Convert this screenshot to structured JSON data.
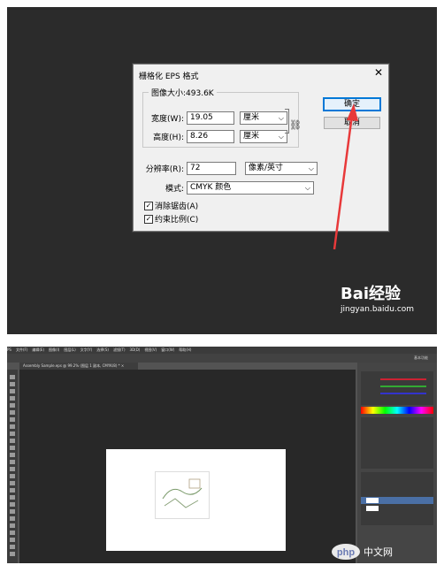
{
  "dialog": {
    "title": "栅格化 EPS 格式",
    "close": "✕",
    "image_size_label": "图像大小:493.6K",
    "width": {
      "label": "宽度(W):",
      "value": "19.05",
      "unit": "厘米"
    },
    "height": {
      "label": "高度(H):",
      "value": "8.26",
      "unit": "厘米"
    },
    "resolution": {
      "label": "分辨率(R):",
      "value": "72",
      "unit": "像素/英寸"
    },
    "mode": {
      "label": "模式:",
      "value": "CMYK 颜色"
    },
    "antialias": {
      "label": "消除锯齿(A)",
      "checked": true
    },
    "constrain": {
      "label": "约束比例(C)",
      "checked": true
    },
    "ok_label": "确定",
    "cancel_label": "取消"
  },
  "watermark": {
    "logo": "Bai经验",
    "site": "jingyan.baidu.com"
  },
  "photoshop": {
    "menu": [
      "PS",
      "文件(F)",
      "编辑(E)",
      "图像(I)",
      "图层(L)",
      "文字(Y)",
      "选择(S)",
      "滤镜(T)",
      "3D(D)",
      "视图(V)",
      "窗口(W)",
      "帮助(H)"
    ],
    "doc_tab": "Assembly Sample.eps @ 99.2% (图层 1 副本, CMYK/8) * ×",
    "workspace": "基本功能"
  },
  "php_watermark": "php 中文网",
  "colors": {
    "dialog_bg": "#f0f0f0",
    "ok_border": "#0078d7",
    "arrow": "#e8393a",
    "dark_bg": "#2b2b2b",
    "ps_bg": "#535353"
  }
}
